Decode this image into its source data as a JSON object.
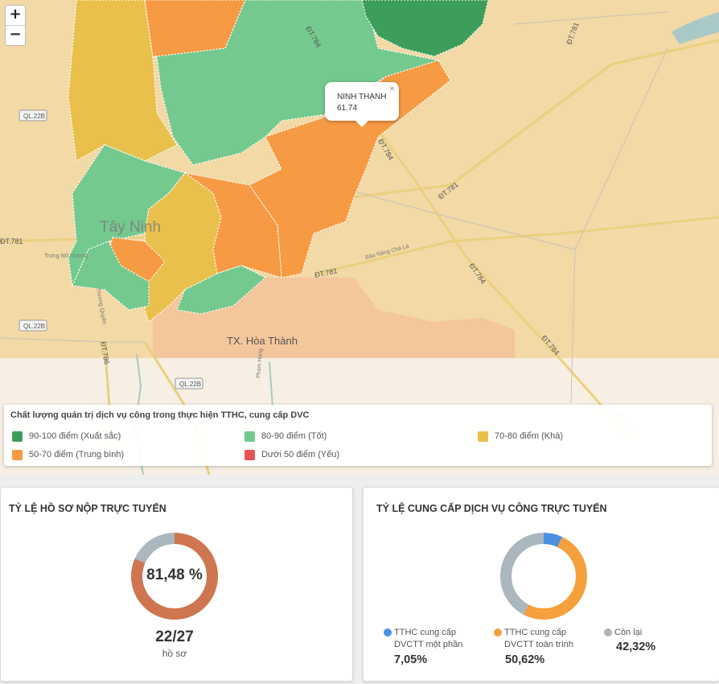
{
  "map": {
    "zoom_in": "+",
    "zoom_out": "−",
    "labels": {
      "city": "Tây Ninh",
      "town": "TX. Hòa Thành",
      "road_ql22b": "QL.22B",
      "road_dt781": "ĐT.781",
      "road_dt784": "ĐT.784",
      "road_dt786": "ĐT.786",
      "road_bau_nang": "Bàu Năng Chà Là",
      "road_trung_nu": "Trưng Nữ Vương",
      "road_trung_quyen": "Trương Quyền",
      "road_pham_hung": "Phạm Hùng"
    },
    "popup": {
      "name": "NINH THẠNH",
      "value": "61.74",
      "close": "×"
    },
    "colors": {
      "xuat_sac": "#3d9e5b",
      "tot": "#74c98e",
      "kha": "#e9c04c",
      "trung_binh": "#f69a43",
      "yeu": "#e85454"
    }
  },
  "legend": {
    "title": "Chất lượng quản trị dịch vụ công trong thực hiện TTHC, cung cấp DVC",
    "items": [
      {
        "label": "90-100 điểm (Xuất sắc)",
        "color": "#3d9e5b"
      },
      {
        "label": "80-90 điểm (Tốt)",
        "color": "#74c98e"
      },
      {
        "label": "70-80 điểm (Khá)",
        "color": "#e9c04c"
      },
      {
        "label": "50-70 điểm (Trung bình)",
        "color": "#f69a43"
      },
      {
        "label": "Dưới 50 điểm (Yếu)",
        "color": "#e85454"
      }
    ]
  },
  "online_submission": {
    "title": "TỶ LỆ HỒ SƠ NỘP TRỰC TUYẾN",
    "percent_label": "81,48 %",
    "percent": 81.48,
    "count": "22/27",
    "unit": "hồ sơ",
    "colors": {
      "done": "#cf7650",
      "rest": "#aab7bf"
    }
  },
  "online_service": {
    "title": "TỶ LỆ CUNG CẤP DỊCH VỤ CÔNG TRỰC TUYẾN",
    "segments": [
      {
        "label_line1": "TTHC cung cấp",
        "label_line2": "DVCTT một phần",
        "percent_label": "7,05%",
        "percent": 7.05,
        "color": "#4a90e2"
      },
      {
        "label_line1": "TTHC cung cấp",
        "label_line2": "DVCTT toàn trình",
        "percent_label": "50,62%",
        "percent": 50.62,
        "color": "#f5a03c"
      },
      {
        "label_line1": "Còn lại",
        "label_line2": "",
        "percent_label": "42,32%",
        "percent": 42.32,
        "color": "#aab7bf"
      }
    ]
  }
}
